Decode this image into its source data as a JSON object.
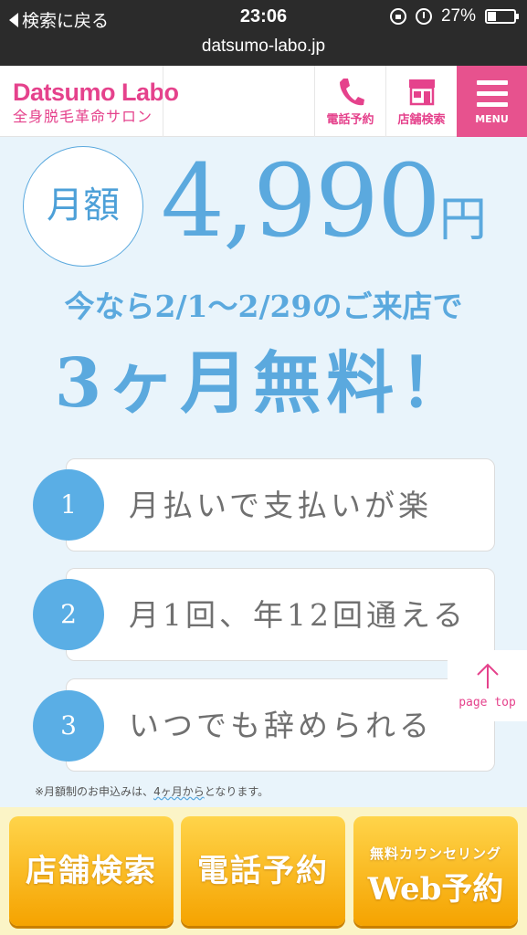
{
  "status_bar": {
    "back_label": "検索に戻る",
    "time": "23:06",
    "battery": "27%"
  },
  "url": "datsumo-labo.jp",
  "header": {
    "logo_name": "Datsumo Labo",
    "logo_sub": "全身脱毛革命サロン",
    "tel_label": "電話予約",
    "shop_label": "店舗検索",
    "menu_label": "MENU"
  },
  "hero": {
    "circle_label": "月額",
    "price": "4,990",
    "price_unit": "円",
    "campaign": "今なら2/1〜2/29のご来店で",
    "free": "3ヶ月無料！"
  },
  "features": [
    {
      "num": "1",
      "text": "月払いで支払いが楽"
    },
    {
      "num": "2",
      "text": "月1回、年12回通える"
    },
    {
      "num": "3",
      "text": "いつでも辞められる"
    }
  ],
  "note": {
    "prefix": "※月額制のお申込みは、",
    "emphasis": "4ヶ月から",
    "suffix": "となります。"
  },
  "page_top_label": "page top",
  "cta": {
    "shop": "店舗検索",
    "tel": "電話予約",
    "web_small": "無料カウンセリング",
    "web_big": "Web予約"
  },
  "colors": {
    "brand_pink": "#e5428c",
    "brand_blue": "#5ba9de",
    "cta_orange": "#f5a300"
  }
}
